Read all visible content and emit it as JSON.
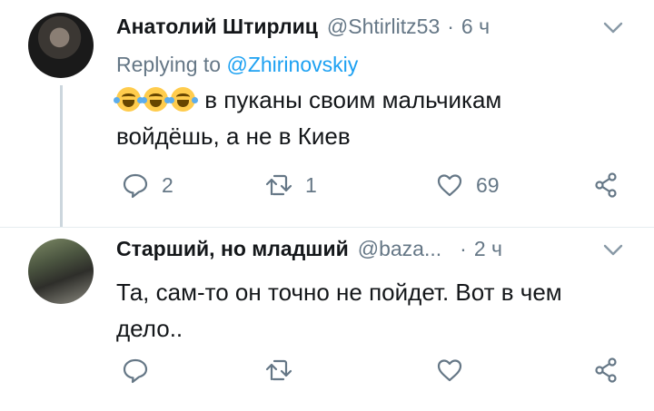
{
  "tweets": [
    {
      "name": "Анатолий Штирлиц",
      "handle": "@Shtirlitz53",
      "time": "6 ч",
      "replying_prefix": "Replying to",
      "replying_to": "@Zhirinovskiy",
      "text_line1": "в пуканы своим мальчикам",
      "text_line2": "войдёшь, а не в Киев",
      "replies": "2",
      "retweets": "1",
      "likes": "69"
    },
    {
      "name": "Старший, но младший",
      "handle": "@baza...",
      "time": "2 ч",
      "text_line1": "Та, сам-то он точно не пойдет. Вот в чем",
      "text_line2": "дело.."
    }
  ],
  "icons": [
    "reply-icon",
    "retweet-icon",
    "like-icon",
    "share-icon",
    "chevron-down-icon"
  ],
  "colors": {
    "accent": "#1da1f2",
    "muted": "#657786",
    "text": "#14171a"
  }
}
